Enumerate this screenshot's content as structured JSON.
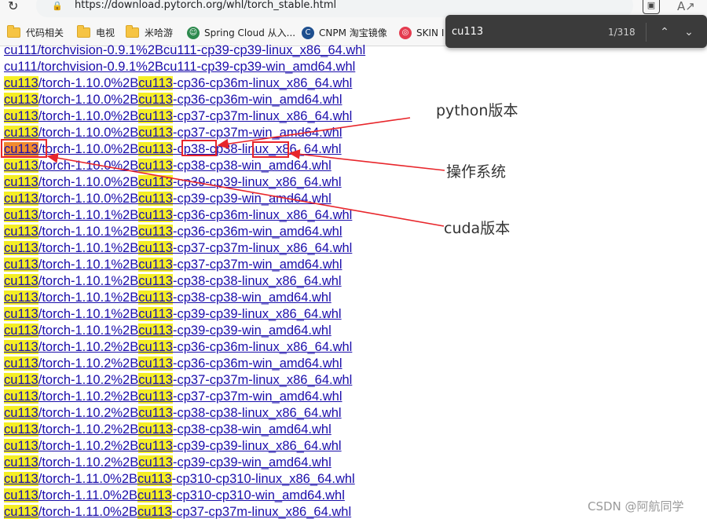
{
  "browser": {
    "url": "https://download.pytorch.org/whl/torch_stable.html",
    "reload_glyph": "↻"
  },
  "bookmarks": [
    {
      "label": "代码相关",
      "icon": "folder-icon"
    },
    {
      "label": "电视",
      "icon": "folder-icon"
    },
    {
      "label": "米哈游",
      "icon": "folder-icon"
    },
    {
      "label": "Spring Cloud 从入...",
      "icon": "avatar-icon"
    },
    {
      "label": "CNPM 淘宝镜像",
      "icon": "cnpm-icon"
    },
    {
      "label": "SKIN I",
      "icon": "skin-icon"
    }
  ],
  "find": {
    "query": "cu113",
    "count": "1/318"
  },
  "links": {
    "pre": [
      "cu111/torchvision-0.9.1%2Bcu111-cp39-cp39-linux_x86_64.whl",
      "cu111/torchvision-0.9.1%2Bcu111-cp39-cp39-win_amd64.whl"
    ],
    "prefix": "cu113",
    "rows": [
      {
        "v": "/torch-1.10.0%2B",
        "s": "-cp36-cp36m-linux_x86_64.whl"
      },
      {
        "v": "/torch-1.10.0%2B",
        "s": "-cp36-cp36m-win_amd64.whl"
      },
      {
        "v": "/torch-1.10.0%2B",
        "s": "-cp37-cp37m-linux_x86_64.whl"
      },
      {
        "v": "/torch-1.10.0%2B",
        "s": "-cp37-cp37m-win_amd64.whl"
      },
      {
        "v": "/torch-1.10.0%2B",
        "s": "-cp38-cp38-linux_x86_64.whl"
      },
      {
        "v": "/torch-1.10.0%2B",
        "s": "-cp38-cp38-win_amd64.whl"
      },
      {
        "v": "/torch-1.10.0%2B",
        "s": "-cp39-cp39-linux_x86_64.whl"
      },
      {
        "v": "/torch-1.10.0%2B",
        "s": "-cp39-cp39-win_amd64.whl"
      },
      {
        "v": "/torch-1.10.1%2B",
        "s": "-cp36-cp36m-linux_x86_64.whl"
      },
      {
        "v": "/torch-1.10.1%2B",
        "s": "-cp36-cp36m-win_amd64.whl"
      },
      {
        "v": "/torch-1.10.1%2B",
        "s": "-cp37-cp37m-linux_x86_64.whl"
      },
      {
        "v": "/torch-1.10.1%2B",
        "s": "-cp37-cp37m-win_amd64.whl"
      },
      {
        "v": "/torch-1.10.1%2B",
        "s": "-cp38-cp38-linux_x86_64.whl"
      },
      {
        "v": "/torch-1.10.1%2B",
        "s": "-cp38-cp38-win_amd64.whl"
      },
      {
        "v": "/torch-1.10.1%2B",
        "s": "-cp39-cp39-linux_x86_64.whl"
      },
      {
        "v": "/torch-1.10.1%2B",
        "s": "-cp39-cp39-win_amd64.whl"
      },
      {
        "v": "/torch-1.10.2%2B",
        "s": "-cp36-cp36m-linux_x86_64.whl"
      },
      {
        "v": "/torch-1.10.2%2B",
        "s": "-cp36-cp36m-win_amd64.whl"
      },
      {
        "v": "/torch-1.10.2%2B",
        "s": "-cp37-cp37m-linux_x86_64.whl"
      },
      {
        "v": "/torch-1.10.2%2B",
        "s": "-cp37-cp37m-win_amd64.whl"
      },
      {
        "v": "/torch-1.10.2%2B",
        "s": "-cp38-cp38-linux_x86_64.whl"
      },
      {
        "v": "/torch-1.10.2%2B",
        "s": "-cp38-cp38-win_amd64.whl"
      },
      {
        "v": "/torch-1.10.2%2B",
        "s": "-cp39-cp39-linux_x86_64.whl"
      },
      {
        "v": "/torch-1.10.2%2B",
        "s": "-cp39-cp39-win_amd64.whl"
      },
      {
        "v": "/torch-1.11.0%2B",
        "s": "-cp310-cp310-linux_x86_64.whl"
      },
      {
        "v": "/torch-1.11.0%2B",
        "s": "-cp310-cp310-win_amd64.whl"
      },
      {
        "v": "/torch-1.11.0%2B",
        "s": "-cp37-cp37m-linux_x86_64.whl"
      }
    ]
  },
  "annotations": {
    "python": "python版本",
    "os": "操作系统",
    "cuda": "cuda版本",
    "color": "#e8262b"
  },
  "watermark": "CSDN @阿航同学"
}
